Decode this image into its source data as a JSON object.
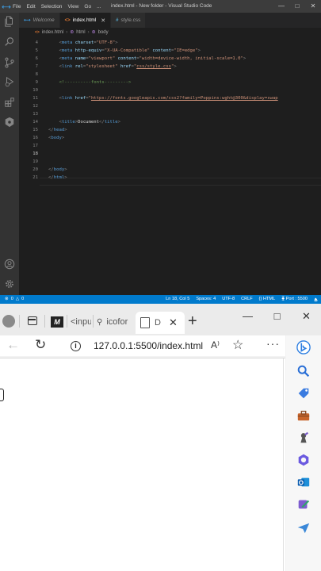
{
  "vscode": {
    "title": "index.html - New folder - Visual Studio Code",
    "menu": [
      "File",
      "Edit",
      "Selection",
      "View",
      "Go",
      "..."
    ],
    "window_controls": [
      "—",
      "□",
      "✕"
    ],
    "activity_icons": [
      "files-icon",
      "search-icon",
      "source-control-icon",
      "run-debug-icon",
      "extensions-icon",
      "remote-icon",
      "accounts-icon",
      "settings-icon"
    ],
    "tabs": [
      {
        "icon": "☰",
        "label": "Welcome",
        "active": false
      },
      {
        "icon": "<>",
        "label": "index.html",
        "active": true
      },
      {
        "icon": "#",
        "label": "style.css",
        "active": false
      }
    ],
    "breadcrumbs": [
      "index.html",
      "html",
      "body"
    ],
    "lines": [
      {
        "n": "4",
        "segs": [
          [
            "p",
            "    "
          ],
          [
            "u",
            "<"
          ],
          [
            "t",
            "meta "
          ],
          [
            "a",
            "charset"
          ],
          [
            "u",
            "="
          ],
          [
            "s",
            "\"UTF-8\""
          ],
          [
            "u",
            ">"
          ]
        ]
      },
      {
        "n": "5",
        "segs": [
          [
            "p",
            "    "
          ],
          [
            "u",
            "<"
          ],
          [
            "t",
            "meta "
          ],
          [
            "a",
            "http-equiv"
          ],
          [
            "u",
            "="
          ],
          [
            "s",
            "\"X-UA-Compatible\" "
          ],
          [
            "a",
            "content"
          ],
          [
            "u",
            "="
          ],
          [
            "s",
            "\"IE=edge\""
          ],
          [
            "u",
            ">"
          ]
        ]
      },
      {
        "n": "6",
        "segs": [
          [
            "p",
            "    "
          ],
          [
            "u",
            "<"
          ],
          [
            "t",
            "meta "
          ],
          [
            "a",
            "name"
          ],
          [
            "u",
            "="
          ],
          [
            "s",
            "\"viewport\" "
          ],
          [
            "a",
            "content"
          ],
          [
            "u",
            "="
          ],
          [
            "s",
            "\"width=device-width, initial-scale=1.0\""
          ],
          [
            "u",
            ">"
          ]
        ]
      },
      {
        "n": "7",
        "segs": [
          [
            "p",
            "    "
          ],
          [
            "u",
            "<"
          ],
          [
            "t",
            "link "
          ],
          [
            "a",
            "rel"
          ],
          [
            "u",
            "="
          ],
          [
            "s",
            "\"stylesheet\" "
          ],
          [
            "a",
            "href"
          ],
          [
            "u",
            "="
          ],
          [
            "s",
            "\""
          ],
          [
            "l",
            "css/style.css"
          ],
          [
            "s",
            "\""
          ],
          [
            "u",
            ">"
          ]
        ]
      },
      {
        "n": "8",
        "segs": []
      },
      {
        "n": "9",
        "segs": [
          [
            "p",
            "    "
          ],
          [
            "c",
            "<!----------fonts--------->"
          ]
        ]
      },
      {
        "n": "10",
        "segs": []
      },
      {
        "n": "11",
        "segs": [
          [
            "p",
            "    "
          ],
          [
            "u",
            "<"
          ],
          [
            "t",
            "link "
          ],
          [
            "a",
            "href"
          ],
          [
            "u",
            "="
          ],
          [
            "s",
            "\""
          ],
          [
            "l",
            "https://fonts.googleapis.com/css2?family=Poppins:wght@300&display=swap"
          ]
        ]
      },
      {
        "n": "12",
        "segs": []
      },
      {
        "n": "13",
        "segs": []
      },
      {
        "n": "14",
        "segs": [
          [
            "p",
            "    "
          ],
          [
            "u",
            "<"
          ],
          [
            "t",
            "title"
          ],
          [
            "u",
            ">"
          ],
          [
            "x",
            "Document"
          ],
          [
            "u",
            "</"
          ],
          [
            "t",
            "title"
          ],
          [
            "u",
            ">"
          ]
        ]
      },
      {
        "n": "15",
        "segs": [
          [
            "u",
            "</"
          ],
          [
            "t",
            "head"
          ],
          [
            "u",
            ">"
          ]
        ]
      },
      {
        "n": "16",
        "segs": [
          [
            "u",
            "<"
          ],
          [
            "t",
            "body"
          ],
          [
            "u",
            ">"
          ]
        ]
      },
      {
        "n": "17",
        "segs": []
      },
      {
        "n": "18",
        "segs": []
      },
      {
        "n": "19",
        "segs": []
      },
      {
        "n": "20",
        "segs": [
          [
            "u",
            "</"
          ],
          [
            "t",
            "body"
          ],
          [
            "u",
            ">"
          ]
        ]
      },
      {
        "n": "21",
        "segs": [
          [
            "u",
            "</"
          ],
          [
            "t",
            "html"
          ],
          [
            "u",
            ">"
          ]
        ]
      }
    ],
    "current_line": "18",
    "status": {
      "problems_errors": "0",
      "problems_warnings": "0",
      "position": "Ln 18, Col 5",
      "spaces": "Spaces: 4",
      "encoding": "UTF-8",
      "eol": "CRLF",
      "language": "HTML",
      "port": "Port : 5500"
    },
    "colors": {
      "statusbar": "#007acc",
      "editor_bg": "#1e1e1e",
      "tag": "#569cd6",
      "attr": "#9cdcfe",
      "string": "#ce9178",
      "comment": "#6a9955"
    }
  },
  "edge": {
    "tabs": [
      {
        "favicon": "M",
        "label": "",
        "active": false
      },
      {
        "favicon": "",
        "label": "<inpu",
        "active": false
      },
      {
        "favicon": "search-icon",
        "label": "icofor",
        "active": false
      },
      {
        "favicon": "page-icon",
        "label": "D",
        "active": true
      }
    ],
    "tab_close": "✕",
    "new_tab": "+",
    "window_controls": [
      "—",
      "□",
      "✕"
    ],
    "url": "127.0.0.1:5500/index.html",
    "read_aloud": "A⁾",
    "more": "···",
    "sidebar_icons": [
      "bing-chat-icon",
      "search-icon",
      "shopping-tag-icon",
      "toolbox-icon",
      "games-icon",
      "microsoft-365-icon",
      "outlook-icon",
      "drop-icon",
      "send-icon"
    ]
  }
}
